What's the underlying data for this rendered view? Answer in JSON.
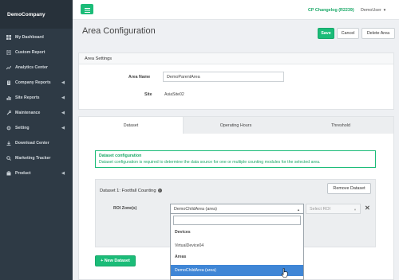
{
  "sidebar": {
    "brand": "DemoCompany",
    "items": [
      {
        "label": "My Dashboard",
        "icon": "dashboard-icon",
        "caret": ""
      },
      {
        "label": "Custom Report",
        "icon": "document-icon",
        "caret": ""
      },
      {
        "label": "Analytics Center",
        "icon": "chart-icon",
        "caret": ""
      },
      {
        "label": "Company Reports",
        "icon": "building-icon",
        "caret": "◀"
      },
      {
        "label": "Site Reports",
        "icon": "chart-bar-icon",
        "caret": "◀"
      },
      {
        "label": "Maintenance",
        "icon": "wrench-icon",
        "caret": "◀"
      },
      {
        "label": "Setting",
        "icon": "gear-icon",
        "caret": "◀"
      },
      {
        "label": "Download Center",
        "icon": "download-icon",
        "caret": ""
      },
      {
        "label": "Marketing Tracker",
        "icon": "search-icon",
        "caret": ""
      },
      {
        "label": "Product",
        "icon": "product-icon",
        "caret": "◀"
      }
    ]
  },
  "topbar": {
    "changelog": "CP Changelog (R2239)",
    "user": "DemoUser",
    "user_caret": "▼"
  },
  "header": {
    "title": "Area Configuration",
    "save": "Save",
    "cancel": "Cancel",
    "delete": "Delete Area"
  },
  "area_settings": {
    "heading": "Area Settings",
    "area_name_label": "Area Name",
    "area_name_value": "DemoParentArea",
    "site_label": "Site",
    "site_value": "AsiaSite02"
  },
  "tabs": [
    "Dataset",
    "Operating Hours",
    "Threshold"
  ],
  "info": {
    "title": "Dataset configuration",
    "text": "Dataset configuration is required to determine the data source for one or multiple counting modules for the selected area."
  },
  "dataset": {
    "title": "Dataset 1: Footfall Counting",
    "help": "?",
    "remove": "Remove Dataset",
    "roi_label": "ROI Zone(s)",
    "roi_value": "DemoChildArea (area)",
    "roi2_placeholder": "Select ROI",
    "arrow": "▲",
    "arrow2": "▼",
    "remove_x": "✕"
  },
  "dropdown": {
    "group_devices": "Devices",
    "option_device": "VirtualDevice04",
    "group_areas": "Areas",
    "option_area": "DemoChildArea (area)"
  },
  "new_dataset": "+ New Dataset",
  "colors": {
    "accent": "#1bbc78",
    "sidebar": "#2e3a45",
    "selected": "#3f86d6"
  }
}
